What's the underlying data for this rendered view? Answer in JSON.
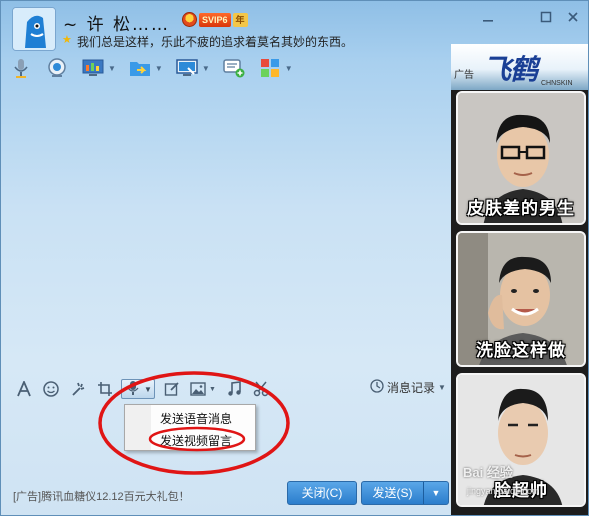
{
  "contact": {
    "nickname": "~   许  松……",
    "vip_badge": "SVIP6",
    "year_badge": "年",
    "signature": "我们总是这样，乐此不疲的追求着莫名其妙的东西。"
  },
  "window_controls": [
    "minimize-icon",
    "maximize-icon",
    "close-icon"
  ],
  "toolbar": {
    "items": [
      {
        "icon": "microphone-icon",
        "has_menu": false
      },
      {
        "icon": "webcam-icon",
        "has_menu": false
      },
      {
        "icon": "remote-desktop-icon",
        "has_menu": true
      },
      {
        "icon": "file-transfer-icon",
        "has_menu": true
      },
      {
        "icon": "screen-share-icon",
        "has_menu": true
      },
      {
        "icon": "message-add-icon",
        "has_menu": false
      },
      {
        "icon": "apps-icon",
        "has_menu": true
      }
    ]
  },
  "input_toolbar": {
    "icons": [
      "font-icon",
      "emoji-icon",
      "nudge-icon",
      "screenshot-icon",
      "voice-icon",
      "edit-icon",
      "image-icon",
      "music-icon",
      "scissors-icon"
    ],
    "message_record_label": "消息记录"
  },
  "context_menu": {
    "items": [
      "发送语音消息",
      "发送视频留言"
    ]
  },
  "bottom": {
    "ad_text": "[广告]腾讯血糖仪12.12百元大礼包！",
    "close_label": "关闭(C)",
    "send_label": "发送(S)"
  },
  "ad_panel": {
    "tag": "广告",
    "brand": "飞鹤",
    "brand_en": "CHNSKIN",
    "cards": [
      "皮肤差的男生",
      "洗脸这样做",
      "脸超帅"
    ]
  },
  "watermark": {
    "text": "Bai 经验",
    "sub": "jingyan.baidu.com"
  },
  "colors": {
    "annotation": "#e01515",
    "send_button": "#2b7dcc",
    "window_border": "#5f8fb8"
  }
}
